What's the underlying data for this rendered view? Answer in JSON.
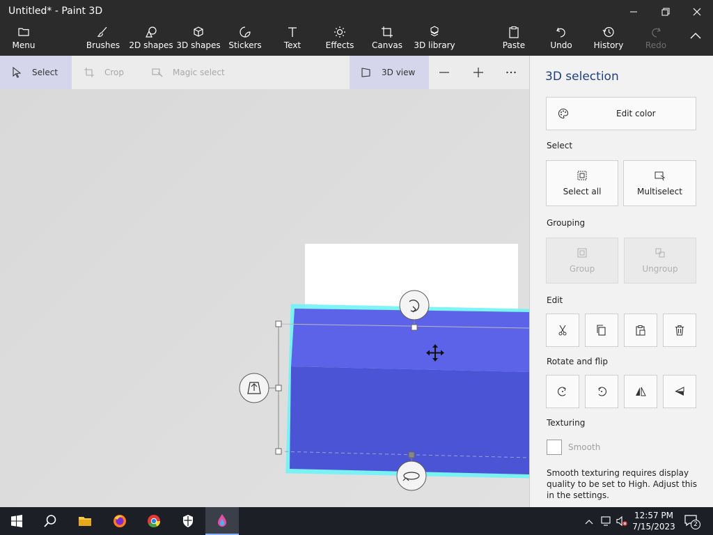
{
  "window": {
    "title": "Untitled* - Paint 3D"
  },
  "toolbar": {
    "menu": "Menu",
    "brushes": "Brushes",
    "shapes2d": "2D shapes",
    "shapes3d": "3D shapes",
    "stickers": "Stickers",
    "text": "Text",
    "effects": "Effects",
    "canvas": "Canvas",
    "library3d": "3D library",
    "paste": "Paste",
    "undo": "Undo",
    "history": "History",
    "redo": "Redo"
  },
  "subbar": {
    "select": "Select",
    "crop": "Crop",
    "magic_select": "Magic select",
    "view3d": "3D view"
  },
  "panel": {
    "title": "3D selection",
    "edit_color": "Edit color",
    "select_heading": "Select",
    "select_all": "Select all",
    "multiselect": "Multiselect",
    "grouping_heading": "Grouping",
    "group": "Group",
    "ungroup": "Ungroup",
    "edit_heading": "Edit",
    "rotate_heading": "Rotate and flip",
    "texturing_heading": "Texturing",
    "smooth": "Smooth",
    "smooth_note": "Smooth texturing requires display quality to be set to High. Adjust this in the settings."
  },
  "taskbar": {
    "time": "12:57 PM",
    "date": "7/15/2023",
    "notifications": "2"
  },
  "colors": {
    "accent": "#1e3e85",
    "shape_top": "#5c63e8",
    "shape_front": "#4c54d6",
    "selection_glow": "#6ff3f5"
  }
}
